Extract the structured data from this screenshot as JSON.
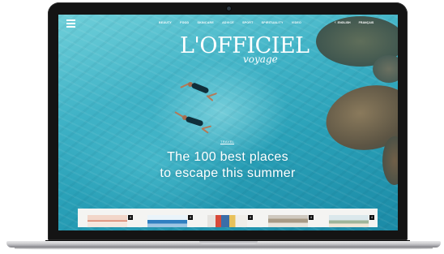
{
  "nav": {
    "menu_icon": "hamburger-icon",
    "links": [
      "BEAUTY",
      "FOOD",
      "SKINCARE",
      "ADVICE",
      "SPORT",
      "SPIRITUALITY",
      "VIDEO"
    ]
  },
  "languages": {
    "primary": "ENGLISH",
    "secondary": "FRANÇAIS",
    "chevron_icon": "chevron-down-icon"
  },
  "logo": {
    "main": "L'OFFICIEL",
    "sub": "voyage"
  },
  "hero": {
    "kicker": "TRAVEL",
    "headline_line1": "The 100 best places",
    "headline_line2": "to escape this summer"
  },
  "articles": [
    {
      "badge": "4",
      "image": "beach-thumbnail"
    },
    {
      "badge": "4",
      "image": "pool-thumbnail"
    },
    {
      "badge": "4",
      "image": "surfboards-thumbnail"
    },
    {
      "badge": "4",
      "image": "boardwalk-thumbnail"
    },
    {
      "badge": "4",
      "image": "coast-thumbnail"
    }
  ],
  "colors": {
    "water": "#2aa1b8",
    "bezel": "#141414",
    "strip": "#f4f4f2"
  }
}
